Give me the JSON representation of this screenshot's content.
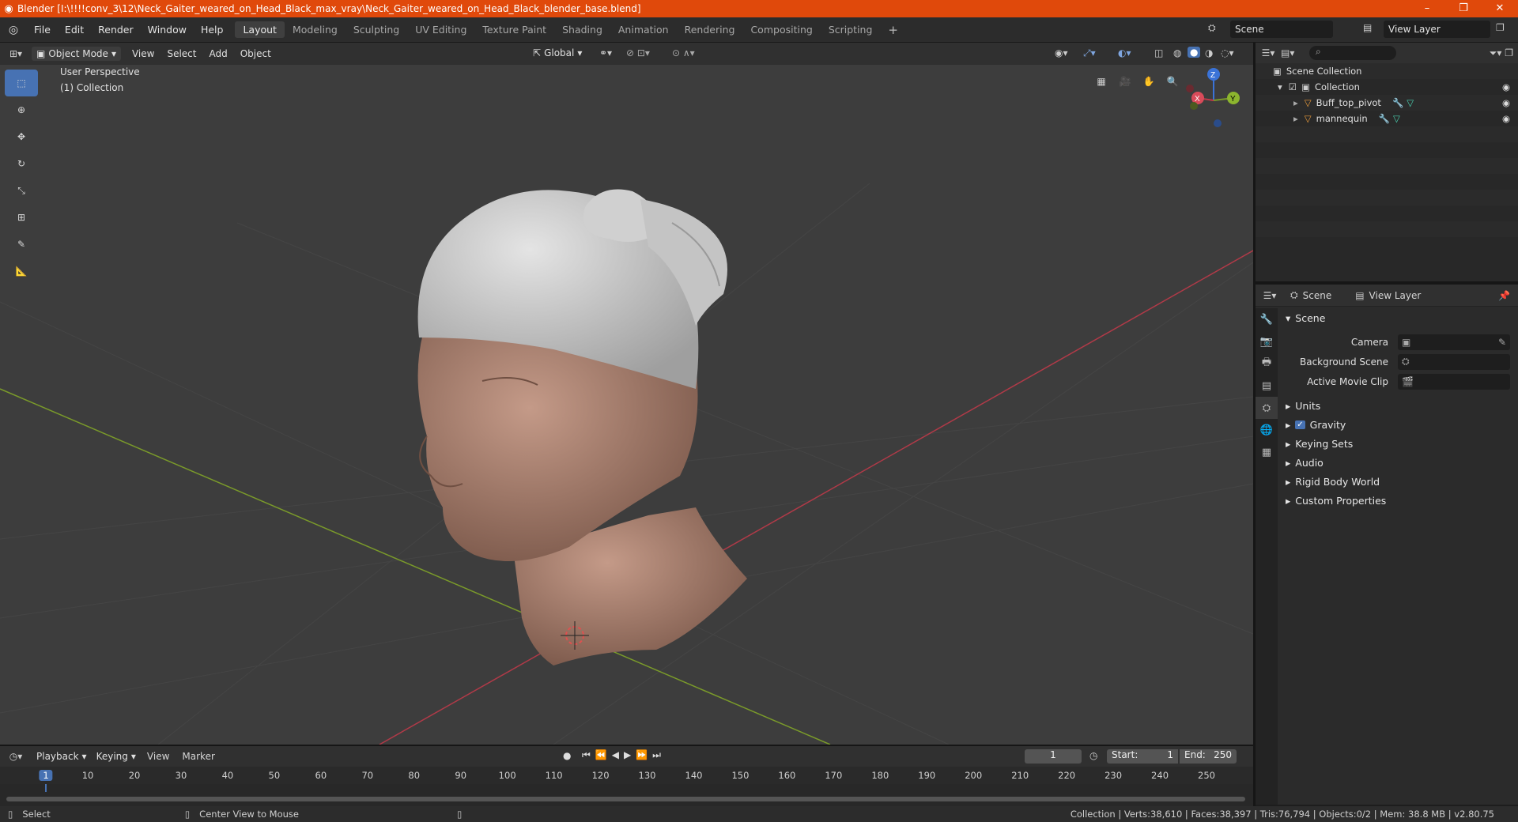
{
  "window": {
    "title": "Blender [I:\\!!!!conv_3\\12\\Neck_Gaiter_weared_on_Head_Black_max_vray\\Neck_Gaiter_weared_on_Head_Black_blender_base.blend]",
    "minimize": "–",
    "maximize": "❐",
    "close": "✕"
  },
  "menu": [
    "File",
    "Edit",
    "Render",
    "Window",
    "Help"
  ],
  "workspaces": [
    "Layout",
    "Modeling",
    "Sculpting",
    "UV Editing",
    "Texture Paint",
    "Shading",
    "Animation",
    "Rendering",
    "Compositing",
    "Scripting"
  ],
  "active_workspace": "Layout",
  "scene_selector": "Scene",
  "view_layer_selector": "View Layer",
  "viewport": {
    "mode": "Object Mode",
    "menus": [
      "View",
      "Select",
      "Add",
      "Object"
    ],
    "orientation": "Global",
    "overlay_line1": "User Perspective",
    "overlay_line2": "(1) Collection",
    "gizmo": {
      "x": "X",
      "y": "Y",
      "z": "Z"
    },
    "colors": {
      "bg": "#3d3d3d",
      "x_axis": "#b03a48",
      "y_axis": "#7a9a2a",
      "skin": "#a87d6c",
      "cloth": "#c9c9c9",
      "accent": "#4772b3"
    }
  },
  "tools": [
    "select-box-icon",
    "cursor-icon",
    "move-icon",
    "rotate-icon",
    "scale-icon",
    "transform-icon",
    "annotate-icon",
    "measure-icon"
  ],
  "outliner": {
    "root": "Scene Collection",
    "collection": "Collection",
    "objects": [
      "Buff_top_pivot",
      "mannequin"
    ]
  },
  "properties": {
    "tab_scene": "Scene",
    "tab_view_layer": "View Layer",
    "panel": "Scene",
    "fields": [
      {
        "label": "Camera",
        "value": ""
      },
      {
        "label": "Background Scene",
        "value": ""
      },
      {
        "label": "Active Movie Clip",
        "value": ""
      }
    ],
    "subpanels": [
      "Units",
      "Gravity",
      "Keying Sets",
      "Audio",
      "Rigid Body World",
      "Custom Properties"
    ]
  },
  "timeline": {
    "menus": [
      "Playback",
      "Keying",
      "View",
      "Marker"
    ],
    "current_frame": "1",
    "start_label": "Start:",
    "start": "1",
    "end_label": "End:",
    "end": "250",
    "ticks": [
      "1",
      "10",
      "20",
      "30",
      "40",
      "50",
      "60",
      "70",
      "80",
      "90",
      "100",
      "110",
      "120",
      "130",
      "140",
      "150",
      "160",
      "170",
      "180",
      "190",
      "200",
      "210",
      "220",
      "230",
      "240",
      "250"
    ]
  },
  "statusbar": {
    "left1": "Select",
    "left2": "Center View to Mouse",
    "right": "Collection | Verts:38,610 | Faces:38,397 | Tris:76,794 | Objects:0/2 | Mem: 38.8 MB | v2.80.75"
  }
}
